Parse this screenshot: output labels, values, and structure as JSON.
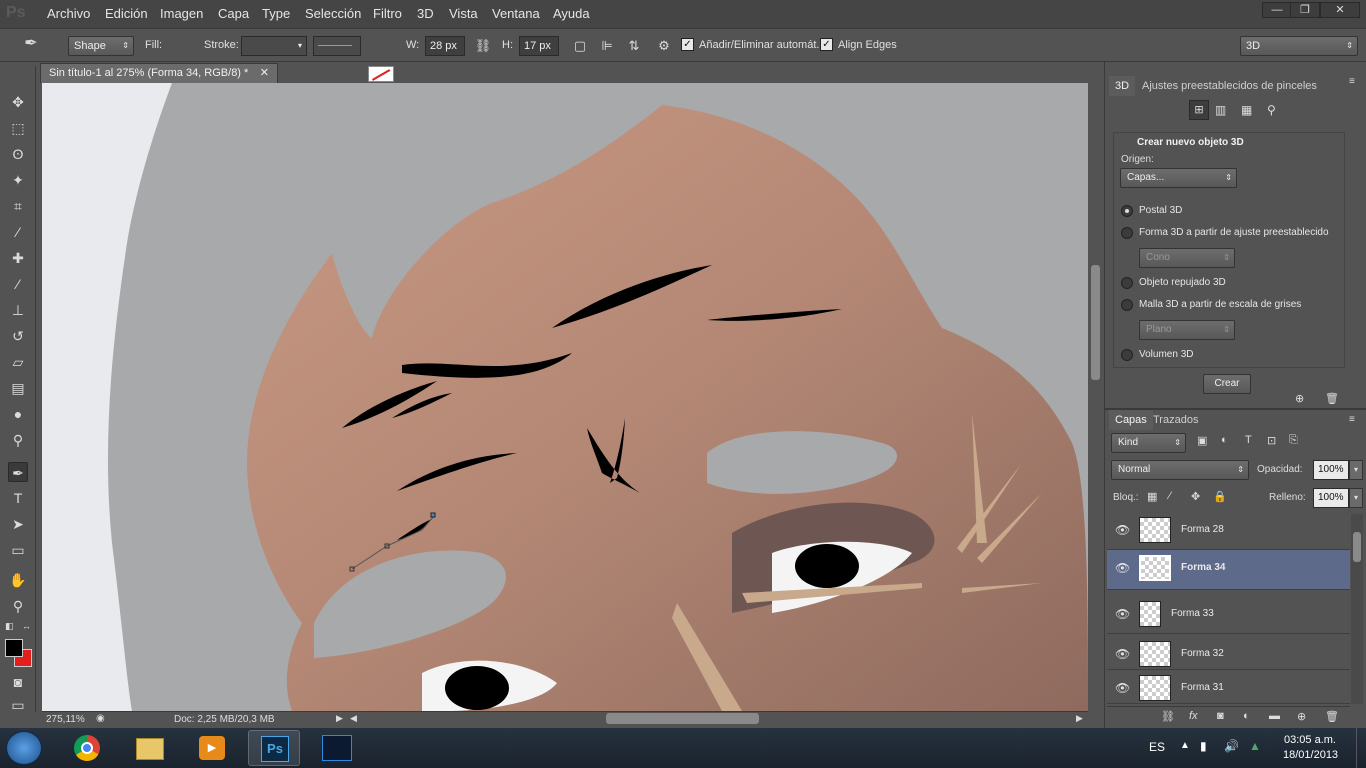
{
  "menu": [
    "Archivo",
    "Edición",
    "Imagen",
    "Capa",
    "Type",
    "Selección",
    "Filtro",
    "3D",
    "Vista",
    "Ventana",
    "Ayuda"
  ],
  "window_controls": {
    "minimize": "—",
    "restore": "❐",
    "close": "✕"
  },
  "options": {
    "tool_mode": "Shape",
    "fill_label": "Fill:",
    "stroke_label": "Stroke:",
    "w_label": "W:",
    "w_value": "28 px",
    "h_label": "H:",
    "h_value": "17 px",
    "auto_add_delete": "Añadir/Eliminar automát.",
    "align_edges": "Align Edges",
    "workspace": "3D"
  },
  "document": {
    "tab_title": "Sin título-1 al 275% (Forma 34, RGB/8) *",
    "zoom": "275,11%",
    "doc_info": "Doc: 2,25 MB/20,3 MB"
  },
  "panel_3d": {
    "tabs": [
      "3D",
      "Ajustes preestablecidos de pinceles"
    ],
    "heading": "Crear nuevo objeto 3D",
    "origin_label": "Origen:",
    "origin_value": "Capas...",
    "options": [
      {
        "label": "Postal 3D",
        "checked": true
      },
      {
        "label": "Forma 3D a partir de ajuste preestablecido",
        "checked": false
      },
      {
        "label": "Objeto repujado 3D",
        "checked": false
      },
      {
        "label": "Malla 3D a partir de escala de grises",
        "checked": false
      },
      {
        "label": "Volumen 3D",
        "checked": false
      }
    ],
    "preset_value": "Cono",
    "mesh_value": "Plano",
    "create_button": "Crear"
  },
  "layers_panel": {
    "tabs": [
      "Capas",
      "Trazados"
    ],
    "filter": "Kind",
    "blend_mode": "Normal",
    "opacity_label": "Opacidad:",
    "opacity_value": "100%",
    "lock_label": "Bloq.:",
    "fill_label": "Relleno:",
    "fill_value": "100%",
    "layers": [
      {
        "name": "Forma 28",
        "selected": false
      },
      {
        "name": "Forma 34",
        "selected": true
      },
      {
        "name": "Forma 33",
        "selected": false
      },
      {
        "name": "Forma 32",
        "selected": false
      },
      {
        "name": "Forma 31",
        "selected": false
      }
    ]
  },
  "taskbar": {
    "language": "ES",
    "time": "03:05 a.m.",
    "date": "18/01/2013"
  },
  "colors": {
    "foreground": "#000000",
    "background": "#e31e1e",
    "skin": "#b58a76",
    "canvas_bg": "#a8a9ab"
  }
}
